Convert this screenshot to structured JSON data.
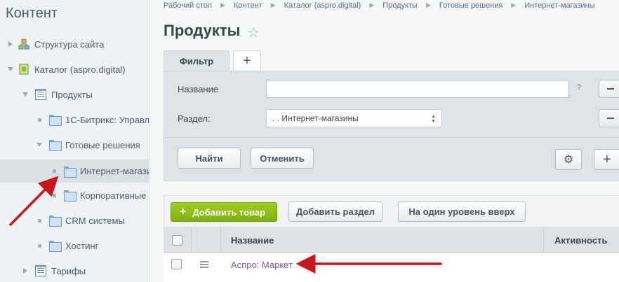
{
  "sidebar": {
    "title": "Контент",
    "items": [
      {
        "label": "Структура сайта"
      },
      {
        "label": "Каталог (aspro.digital)"
      },
      {
        "label": "Продукты"
      },
      {
        "label": "1С-Битрикс: Управл"
      },
      {
        "label": "Готовые решения"
      },
      {
        "label": "Интернет-магази"
      },
      {
        "label": "Корпоративные с"
      },
      {
        "label": "CRM системы"
      },
      {
        "label": "Хостинг"
      },
      {
        "label": "Тарифы"
      }
    ]
  },
  "breadcrumbs": [
    "Рабочий стол",
    "Контент",
    "Каталог (aspro.digital)",
    "Продукты",
    "Готовые решения",
    "Интернет-магазины"
  ],
  "page": {
    "title": "Продукты"
  },
  "filter": {
    "tab_label": "Фильтр",
    "add_tab_label": "+",
    "name_label": "Название",
    "name_value": "",
    "help": "?",
    "section_label": "Раздел:",
    "section_value": ". . Интернет-магазины",
    "find_button": "Найти",
    "cancel_button": "Отменить"
  },
  "toolbar": {
    "add_product": "Добавить товар",
    "add_section": "Добавить раздел",
    "level_up": "На один уровень вверх"
  },
  "grid": {
    "columns": [
      "Название",
      "Активность"
    ],
    "rows": [
      {
        "name": "Аспро: Маркет"
      }
    ]
  },
  "colors": {
    "accent_green": "#8cbd14",
    "annotation_arrow": "#c8161d",
    "link": "#7d5b99"
  },
  "icons": [
    "star-icon",
    "gear-icon",
    "plus-icon",
    "burger-icon",
    "folder-icon",
    "list-icon",
    "structure-icon",
    "catalog-icon"
  ]
}
